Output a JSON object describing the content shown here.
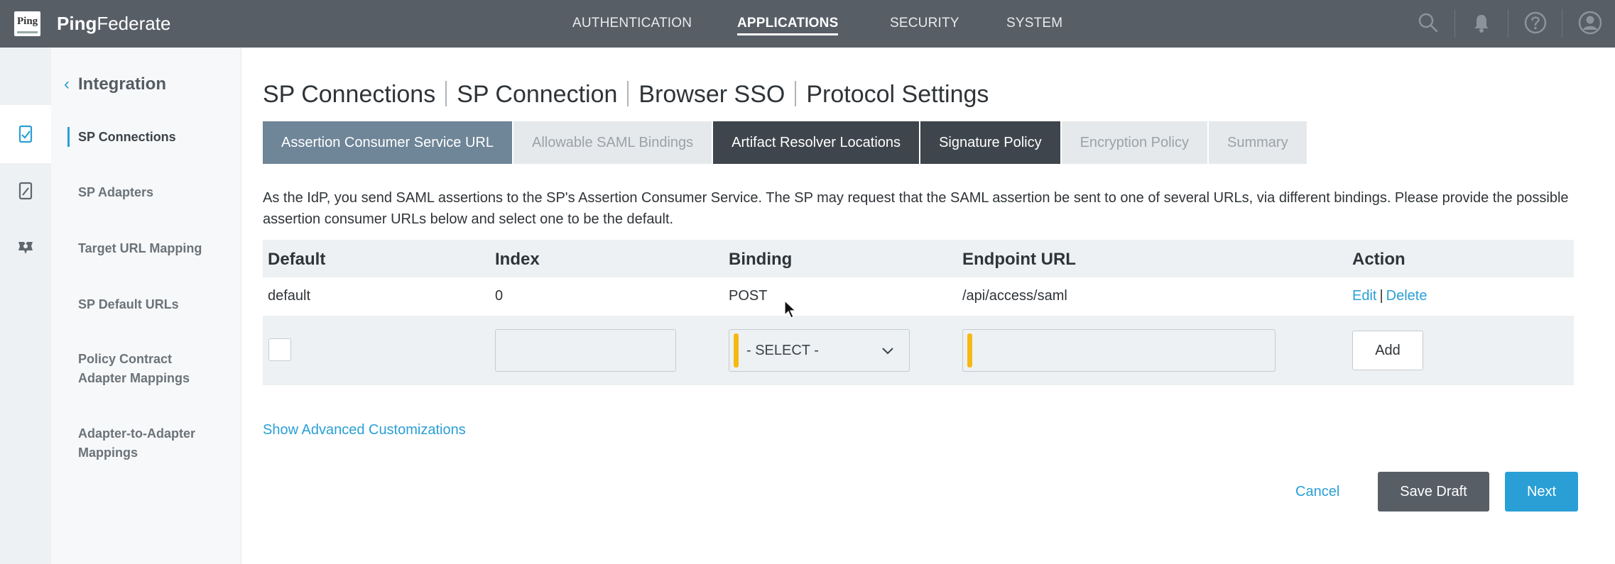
{
  "app": {
    "logo_text": "Ping",
    "brand_bold": "Ping",
    "brand_rest": "Federate"
  },
  "topnav": {
    "items": [
      "AUTHENTICATION",
      "APPLICATIONS",
      "SECURITY",
      "SYSTEM"
    ],
    "active": "APPLICATIONS",
    "icons": [
      "search-icon",
      "bell-icon",
      "help-icon",
      "user-icon"
    ]
  },
  "rail": {
    "icons": [
      "applications-icon",
      "sp-adapters-icon",
      "target-mapping-icon"
    ]
  },
  "sidebar": {
    "title": "Integration",
    "items": [
      {
        "label": "SP Connections",
        "active": true
      },
      {
        "label": "SP Adapters"
      },
      {
        "label": "Target URL Mapping"
      },
      {
        "label": "SP Default URLs"
      },
      {
        "label": "Policy Contract Adapter Mappings"
      },
      {
        "label": "Adapter-to-Adapter Mappings"
      }
    ]
  },
  "breadcrumb": [
    "SP Connections",
    "SP Connection",
    "Browser SSO",
    "Protocol Settings"
  ],
  "tabs": [
    {
      "label": "Assertion Consumer Service URL",
      "state": "current"
    },
    {
      "label": "Allowable SAML Bindings",
      "state": "disabled"
    },
    {
      "label": "Artifact Resolver Locations",
      "state": "enabled"
    },
    {
      "label": "Signature Policy",
      "state": "enabled"
    },
    {
      "label": "Encryption Policy",
      "state": "disabled"
    },
    {
      "label": "Summary",
      "state": "disabled"
    }
  ],
  "description": "As the IdP, you send SAML assertions to the SP's Assertion Consumer Service. The SP may request that the SAML assertion be sent to one of several URLs, via different bindings. Please provide the possible assertion consumer URLs below and select one to be the default.",
  "table": {
    "headers": [
      "Default",
      "Index",
      "Binding",
      "Endpoint URL",
      "Action"
    ],
    "rows": [
      {
        "default": "default",
        "index": "0",
        "binding": "POST",
        "endpoint": "/api/access/saml",
        "edit": "Edit",
        "delete": "Delete",
        "separator": "|"
      }
    ],
    "new_row": {
      "index_value": "",
      "binding_selected": "- SELECT -",
      "endpoint_value": "",
      "add_label": "Add"
    }
  },
  "advanced_link": "Show Advanced Customizations",
  "footer": {
    "cancel": "Cancel",
    "save_draft": "Save Draft",
    "next": "Next"
  },
  "colors": {
    "topbar": "#575e66",
    "accent": "#2a9fd6",
    "required": "#f6b913",
    "tab_current": "#6f8598",
    "tab_enabled": "#3e454c"
  }
}
